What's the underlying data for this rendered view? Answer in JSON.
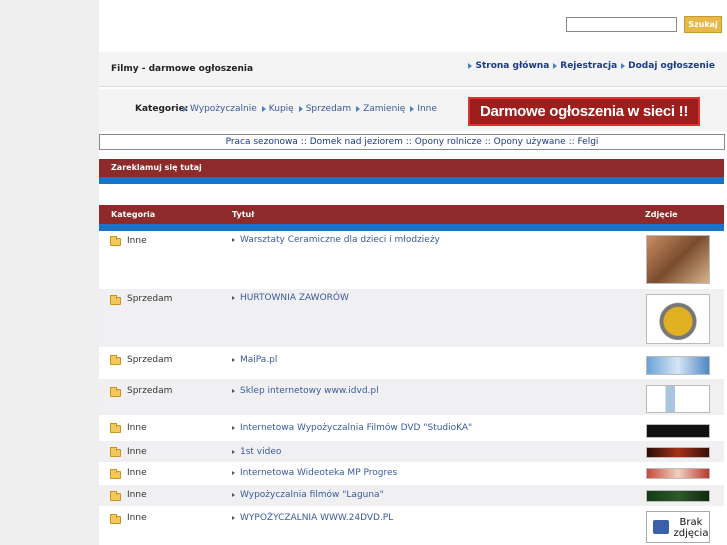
{
  "search": {
    "placeholder": "",
    "button": "Szukaj"
  },
  "header": {
    "title": "Filmy - darmowe ogłoszenia"
  },
  "topnav": [
    "Strona główna",
    "Rejestracja",
    "Dodaj ogłoszenie"
  ],
  "categories": {
    "label": "Kategorie:",
    "items": [
      "Wypożyczalnie",
      "Kupię",
      "Sprzedam",
      "Zamienię",
      "Inne"
    ]
  },
  "banner": "Darmowe ogłoszenia w sieci !!",
  "links": [
    "Praca sezonowa",
    "Domek nad jeziorem",
    "Opony rolnicze",
    "Opony używane",
    "Felgi"
  ],
  "ad": "Zareklamuj się tutaj",
  "table": {
    "headers": {
      "category": "Kategoria",
      "title": "Tytuł",
      "photo": "Zdjęcie"
    },
    "rows": [
      {
        "category": "Inne",
        "title": "Warsztaty Ceramiczne dla dzieci i młodzieży"
      },
      {
        "category": "Sprzedam",
        "title": "HURTOWNIA ZAWORÓW"
      },
      {
        "category": "Sprzedam",
        "title": "MaiPa.pl"
      },
      {
        "category": "Sprzedam",
        "title": "Sklep internetowy www.idvd.pl"
      },
      {
        "category": "Inne",
        "title": "Internetowa Wypożyczalnia Filmów DVD \"StudioKA\""
      },
      {
        "category": "Inne",
        "title": "1st video"
      },
      {
        "category": "Inne",
        "title": "Internetowa Wideoteka MP Progres"
      },
      {
        "category": "Inne",
        "title": "Wypożyczalnia filmów \"Laguna\""
      },
      {
        "category": "Inne",
        "title": "WYPOŻYCZALNIA WWW.24DVD.PL"
      }
    ],
    "no_photo": "Brak zdjęcia"
  },
  "colors": {
    "header_red": "#8e2a2a",
    "accent_blue": "#1a73c8",
    "link": "#3a5a9a"
  }
}
